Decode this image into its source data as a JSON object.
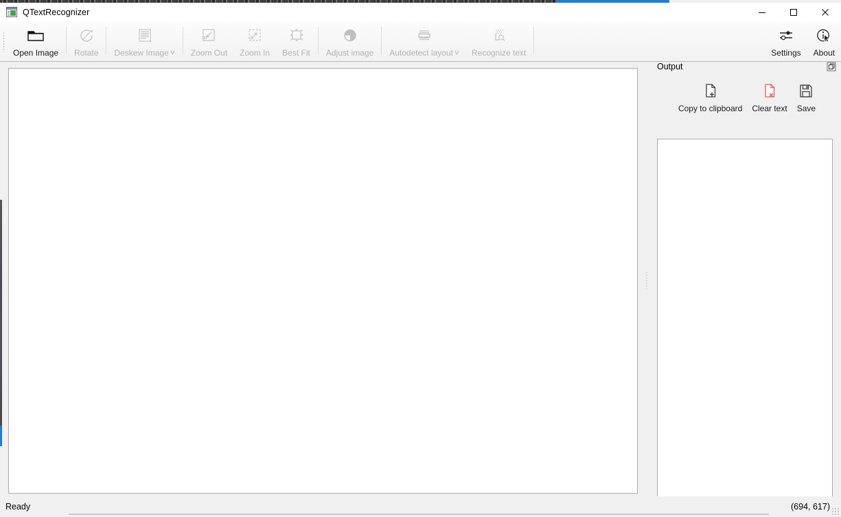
{
  "window": {
    "title": "QTextRecognizer",
    "app_icon": "document-window-icon",
    "controls": {
      "minimize": "minimize-icon",
      "maximize": "maximize-icon",
      "close": "close-icon"
    }
  },
  "toolbar": {
    "items": [
      {
        "label": "Open Image",
        "icon": "folder-open-icon",
        "enabled": true,
        "has_menu": false
      },
      {
        "label": "Rotate",
        "icon": "rotate-icon",
        "enabled": false,
        "has_menu": false
      },
      {
        "label": "Deskew Image",
        "icon": "deskew-lines-icon",
        "enabled": false,
        "has_menu": true
      },
      {
        "label": "Zoom Out",
        "icon": "zoom-out-icon",
        "enabled": false,
        "has_menu": false
      },
      {
        "label": "Zoom In",
        "icon": "zoom-in-icon",
        "enabled": false,
        "has_menu": false
      },
      {
        "label": "Best Fit",
        "icon": "best-fit-icon",
        "enabled": false,
        "has_menu": false
      },
      {
        "label": "Adjust image",
        "icon": "contrast-circle-icon",
        "enabled": false,
        "has_menu": false
      },
      {
        "label": "Autodetect layout",
        "icon": "layout-detect-icon",
        "enabled": false,
        "has_menu": true
      },
      {
        "label": "Recognize text",
        "icon": "recognize-text-icon",
        "enabled": false,
        "has_menu": false
      }
    ],
    "right_items": [
      {
        "label": "Settings",
        "icon": "sliders-icon",
        "enabled": true
      },
      {
        "label": "About",
        "icon": "info-cursor-icon",
        "enabled": true
      }
    ]
  },
  "image_view": {
    "name": "image-canvas",
    "content": ""
  },
  "output_dock": {
    "title": "Output",
    "float_icon": "float-window-icon",
    "actions": [
      {
        "label": "Copy to clipboard",
        "icon": "document-plus-icon",
        "color": "#3c3c3c"
      },
      {
        "label": "Clear text",
        "icon": "document-delete-icon",
        "color": "#e05a5a"
      },
      {
        "label": "Save",
        "icon": "floppy-disk-icon",
        "color": "#3c3c3c"
      }
    ],
    "text_value": "",
    "text_placeholder": ""
  },
  "statusbar": {
    "message": "Ready",
    "coordinates": "(694, 617)"
  },
  "colors": {
    "window_bg": "#f0f0f0",
    "toolbar_bg": "#f7f7f7",
    "canvas_bg": "#ffffff",
    "border": "#ababab",
    "disabled_text": "#b3b3b3",
    "accent_blue": "#1e7fd4",
    "clear_red": "#e05a5a"
  }
}
